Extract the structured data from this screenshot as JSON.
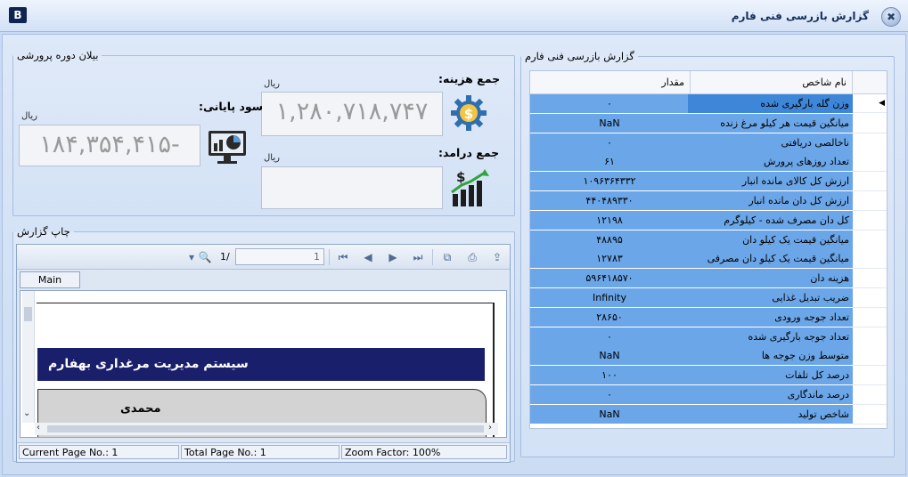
{
  "window": {
    "title": "گزارش بازرسی فنی فارم",
    "app_badge": "B",
    "close_glyph": "✖"
  },
  "summary": {
    "legend": "بیلان دوره پرورشی",
    "cost_label": "جمع هزینه:",
    "income_label": "جمع درامد:",
    "profit_label": "سود پایانی:",
    "unit": "ریال",
    "cost_value": "۱,۲۸۰,۷۱۸,۷۴۷",
    "income_value": "",
    "profit_value": "۱۸۴,۳۵۴,۴۱۵-"
  },
  "print": {
    "legend": "چاپ گزارش",
    "page_input": "1",
    "page_of": "1/",
    "tab_label": "Main Report",
    "report_title": "سیستم مدیریت مرغداری بهفارم",
    "report_name": "محمدی",
    "status": {
      "current_page": "Current Page No.: 1",
      "total_page": "Total Page No.: 1",
      "zoom": "Zoom Factor: 100%"
    }
  },
  "report": {
    "legend": "گزارش بازرسی فنی فارم",
    "col_name": "نام شاخص",
    "col_value": "مقدار",
    "rows": [
      {
        "name": "وزن گله بارگیری شده",
        "value": "۰"
      },
      {
        "name": "میانگین قیمت هر کیلو مرغ زنده",
        "value": "NaN"
      },
      {
        "name": "ناخالصی دریافتی",
        "value": "۰"
      },
      {
        "name": "تعداد روزهای پرورش",
        "value": "۶۱"
      },
      {
        "name": "ارزش کل کالای مانده انبار",
        "value": "۱۰۹۶۳۶۴۳۳۲"
      },
      {
        "name": "ارزش کل دان مانده انبار",
        "value": "۴۴۰۴۸۹۳۳۰"
      },
      {
        "name": "کل دان مصرف شده - کیلوگرم",
        "value": "۱۲۱۹۸"
      },
      {
        "name": "میانگین قیمت یک کیلو دان",
        "value": "۴۸۸۹۵"
      },
      {
        "name": "میانگین قیمت یک کیلو دان مصرفی",
        "value": "۱۲۷۸۳"
      },
      {
        "name": "هزینه دان",
        "value": "۵۹۶۴۱۸۵۷۰"
      },
      {
        "name": "ضریب تبدیل غذایی",
        "value": "Infinity"
      },
      {
        "name": "تعداد جوجه ورودی",
        "value": "۲۸۶۵۰"
      },
      {
        "name": "تعداد جوجه بارگیری شده",
        "value": "۰"
      },
      {
        "name": "متوسط وزن جوجه ها",
        "value": "NaN"
      },
      {
        "name": "درصد کل تلفات",
        "value": "۱۰۰"
      },
      {
        "name": "درصد ماندگاری",
        "value": "۰"
      },
      {
        "name": "شاخص تولید",
        "value": "NaN"
      }
    ]
  },
  "colors": {
    "grid_selected": "#6ba6e8",
    "report_banner": "#1a1f6b",
    "title_bar": "#d2e1f6"
  }
}
